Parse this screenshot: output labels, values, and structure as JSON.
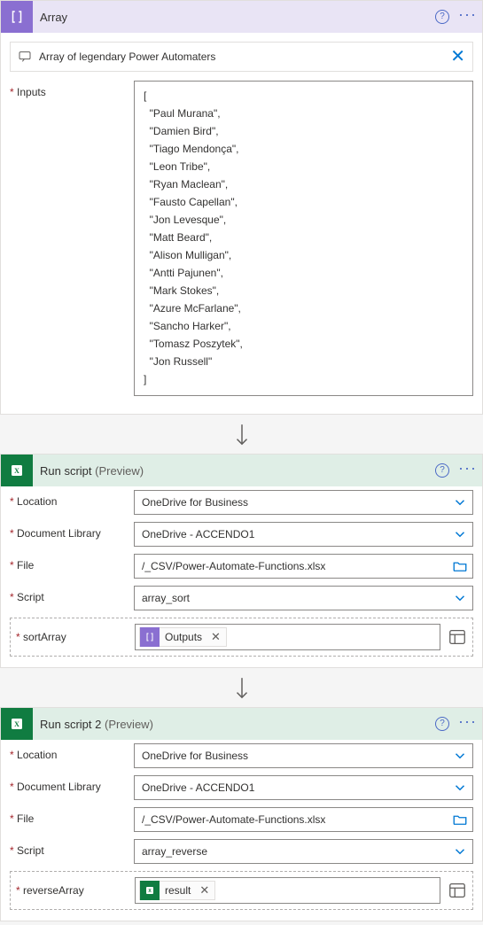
{
  "array": {
    "title": "Array",
    "comment": "Array of legendary Power Automaters",
    "inputs_label": "Inputs",
    "json_lines": [
      "[",
      "  \"Paul Murana\",",
      "  \"Damien Bird\",",
      "  \"Tiago Mendonça\",",
      "  \"Leon Tribe\",",
      "  \"Ryan Maclean\",",
      "  \"Fausto Capellan\",",
      "  \"Jon Levesque\",",
      "  \"Matt Beard\",",
      "  \"Alison Mulligan\",",
      "  \"Antti Pajunen\",",
      "  \"Mark Stokes\",",
      "  \"Azure McFarlane\",",
      "  \"Sancho Harker\",",
      "  \"Tomasz Poszytek\",",
      "  \"Jon Russell\"",
      "]"
    ]
  },
  "run1": {
    "title": "Run script",
    "suffix": "(Preview)",
    "location_label": "Location",
    "location_value": "OneDrive for Business",
    "library_label": "Document Library",
    "library_value": "OneDrive - ACCENDO1",
    "file_label": "File",
    "file_value": "/_CSV/Power-Automate-Functions.xlsx",
    "script_label": "Script",
    "script_value": "array_sort",
    "param_label": "sortArray",
    "token_label": "Outputs"
  },
  "run2": {
    "title": "Run script 2",
    "suffix": "(Preview)",
    "location_label": "Location",
    "location_value": "OneDrive for Business",
    "library_label": "Document Library",
    "library_value": "OneDrive - ACCENDO1",
    "file_label": "File",
    "file_value": "/_CSV/Power-Automate-Functions.xlsx",
    "script_label": "Script",
    "script_value": "array_reverse",
    "param_label": "reverseArray",
    "token_label": "result"
  }
}
